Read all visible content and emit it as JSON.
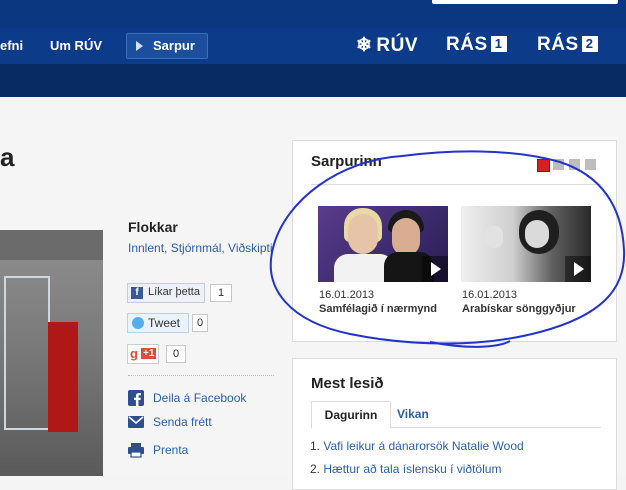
{
  "nav": {
    "efni": "efni",
    "um_ruv": "Um RÚV",
    "sarpur": "Sarpur",
    "brands": [
      {
        "label": "RÚV",
        "icon": "snowflake-icon"
      },
      {
        "label": "RÁS",
        "num": "1"
      },
      {
        "label": "RÁS",
        "num": "2"
      }
    ]
  },
  "article": {
    "title_fragment": "a",
    "flokkar_heading": "Flokkar",
    "flokkar_links": "Innlent, Stjórnmál, Viðskipti",
    "social": {
      "like_label": "Líkar þetta",
      "like_count": "1",
      "tweet_label": "Tweet",
      "tweet_count": "0",
      "gplus_label": "+1",
      "gplus_count": "0"
    },
    "share": [
      {
        "label": "Deila á Facebook",
        "icon": "facebook-icon"
      },
      {
        "label": "Senda frétt",
        "icon": "email-icon"
      },
      {
        "label": "Prenta",
        "icon": "printer-icon"
      }
    ]
  },
  "sarpurinn": {
    "heading": "Sarpurinn",
    "pager_active_color": "#d62020",
    "pager_inactive_color": "#bdbdbd",
    "items": [
      {
        "date": "16.01.2013",
        "title": "Samfélagið í nærmynd"
      },
      {
        "date": "16.01.2013",
        "title": "Arabískar sönggyðjur"
      }
    ]
  },
  "mest_lesid": {
    "heading": "Mest lesið",
    "tabs": [
      "Dagurinn",
      "Vikan"
    ],
    "items": [
      {
        "num": "1.",
        "title": "Vafi leikur á dánarorsök Natalie Wood"
      },
      {
        "num": "2.",
        "title": "Hættur að tala íslensku í viðtölum"
      }
    ]
  },
  "colors": {
    "header_blue": "#0c3b8a",
    "link_blue": "#2a5fa8",
    "annotation_blue": "#2233cc"
  }
}
